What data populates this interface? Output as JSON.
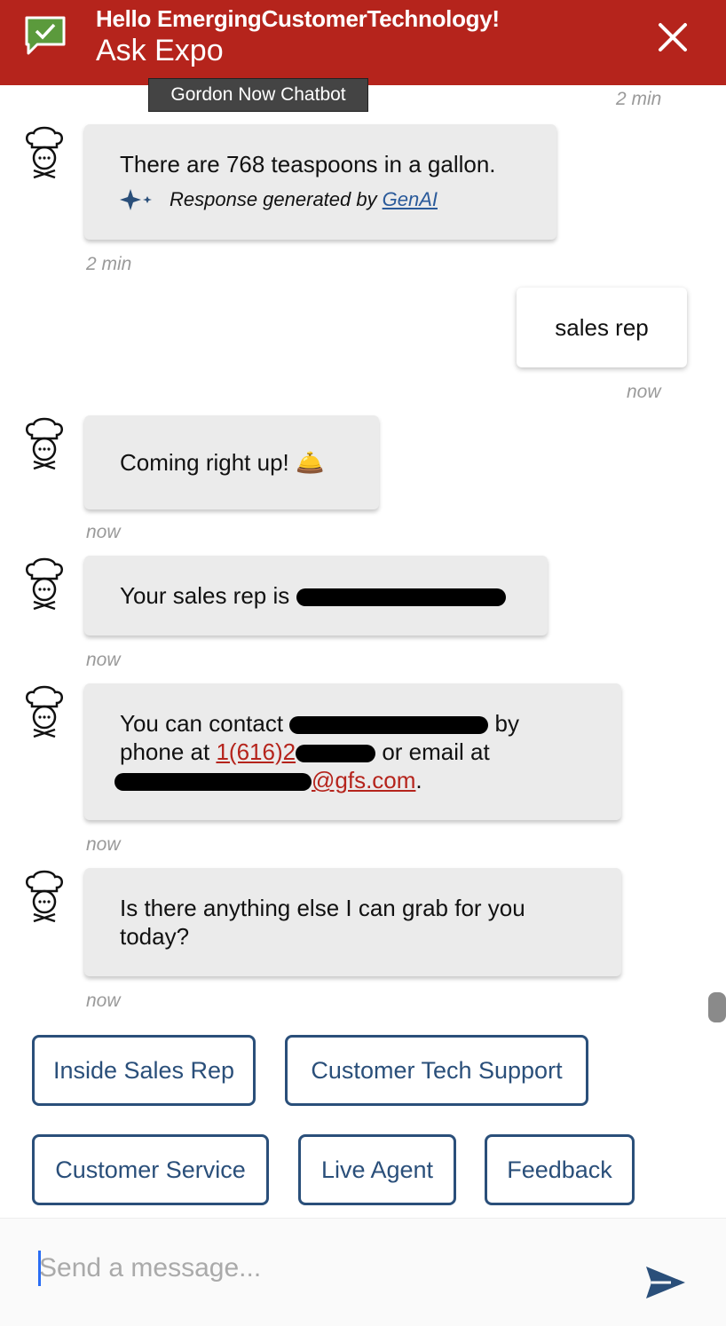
{
  "header": {
    "greeting": "Hello EmergingCustomerTechnology!",
    "title": "Ask Expo",
    "logo_icon": "chat-check-icon",
    "close_icon": "close-icon",
    "bg_color": "#b5241c"
  },
  "tooltip": "Gordon Now Chatbot",
  "messages": [
    {
      "sender": "bot",
      "text": "There are 768 teaspoons in a gallon.",
      "genai_prefix": "Response generated by",
      "genai_link": "GenAI",
      "time_above": "2 min",
      "time": "2 min"
    },
    {
      "sender": "user",
      "text": "sales rep",
      "time": "now"
    },
    {
      "sender": "bot",
      "text": "Coming right up!",
      "emoji": "🛎️",
      "time": "now"
    },
    {
      "sender": "bot",
      "text": "Your sales rep is",
      "time": "now"
    },
    {
      "sender": "bot",
      "line1_a": "You can contact",
      "line1_b": "by",
      "line2_a": "phone at",
      "phone": "1(616)2",
      "line2_b": "or email at",
      "email": "@gfs.com",
      "email_end": ".",
      "time": "now"
    },
    {
      "sender": "bot",
      "line1": "Is there anything else I can grab for you",
      "line2": "today?",
      "time": "now"
    }
  ],
  "quick_replies": [
    "Inside Sales Rep",
    "Customer Tech Support",
    "Customer Service",
    "Live Agent",
    "Feedback"
  ],
  "composer": {
    "placeholder": "Send a message...",
    "send_icon": "send-icon"
  },
  "colors": {
    "accent": "#2a4f7a",
    "link": "#b5241c",
    "genai_link": "#2a5a9a"
  }
}
